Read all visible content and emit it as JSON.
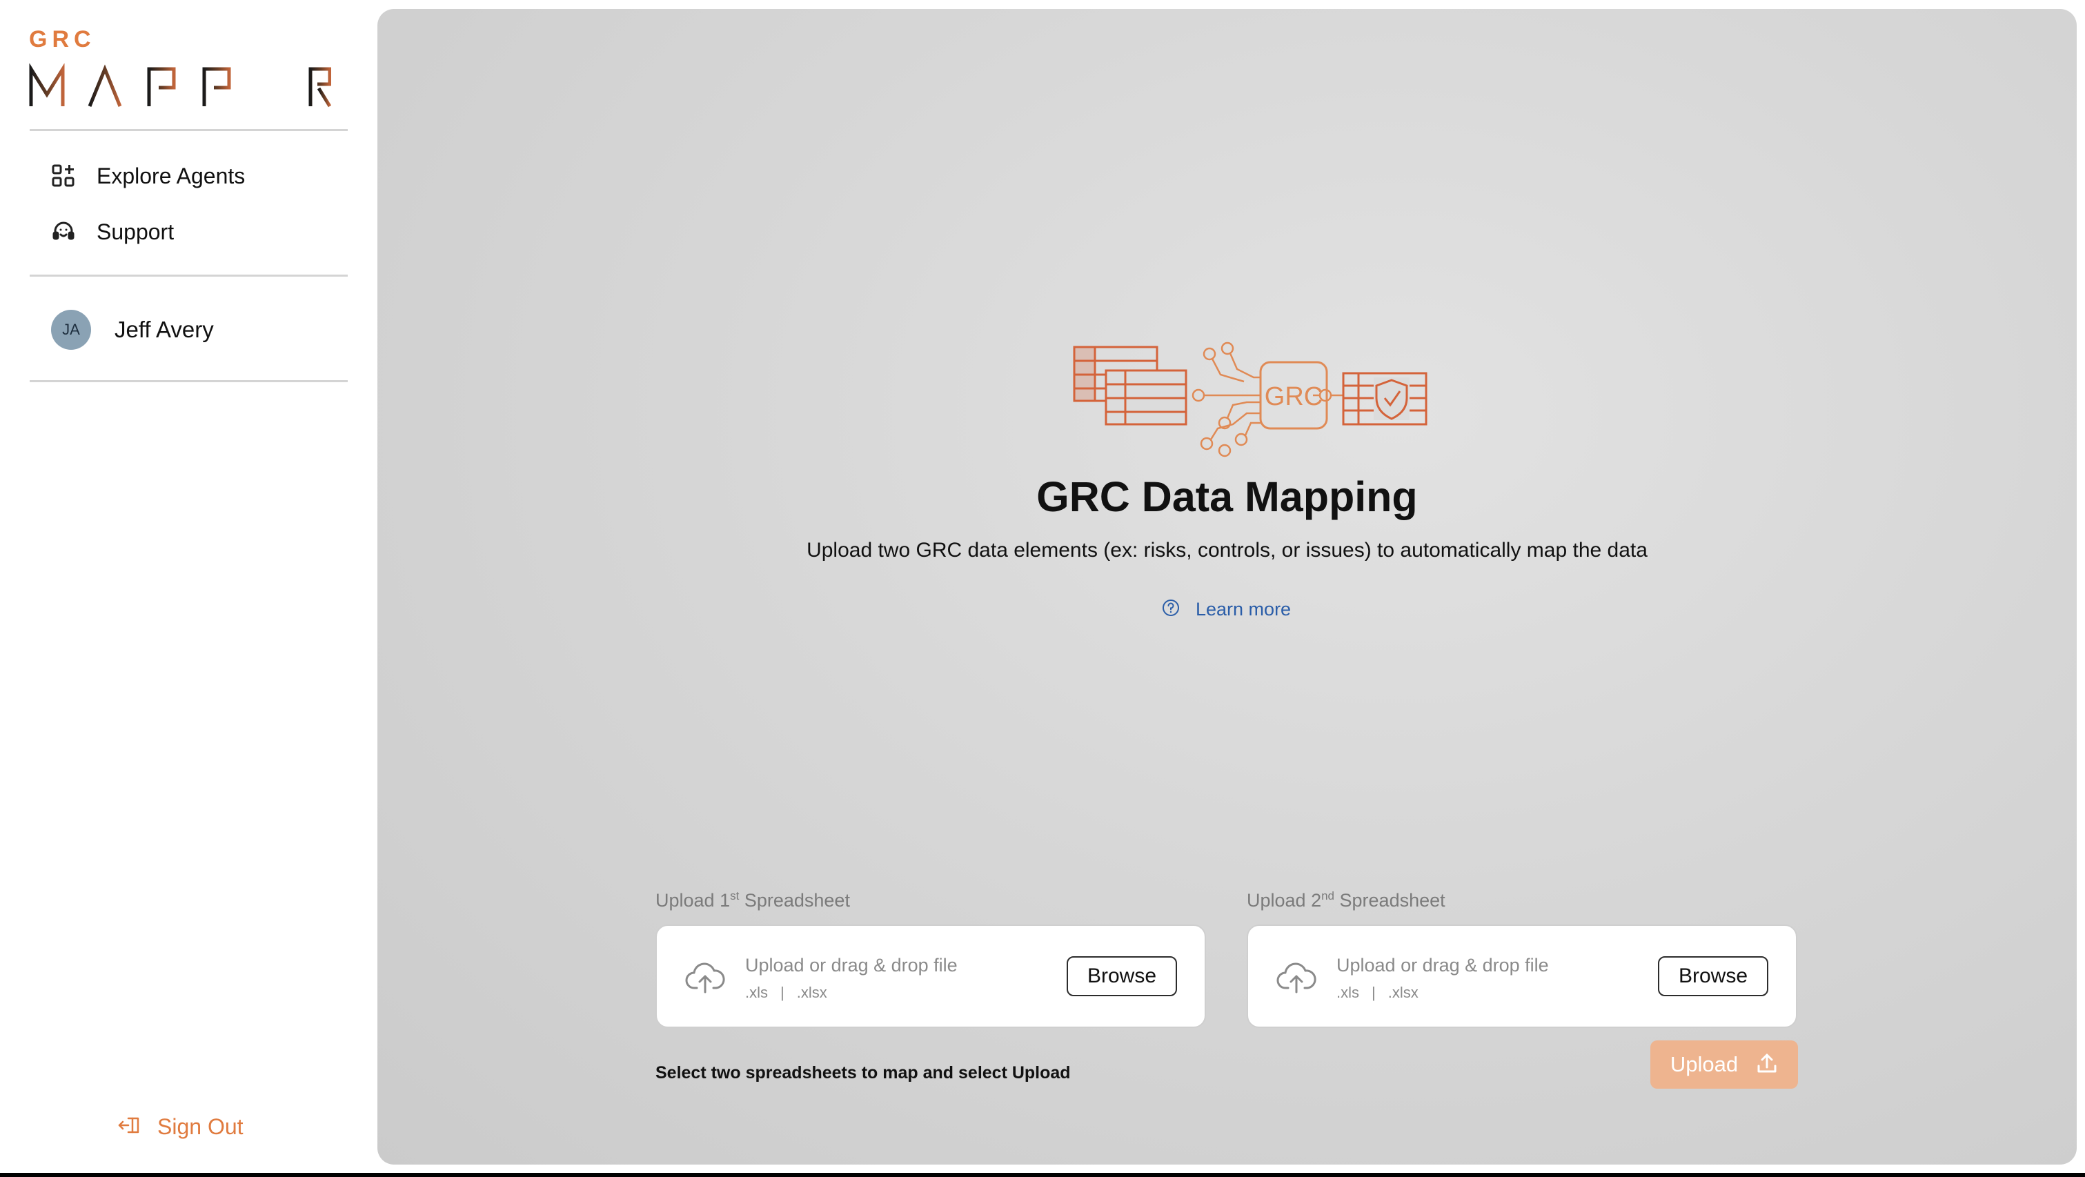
{
  "theme": {
    "accent": "#e07b3f",
    "link": "#2a5da8",
    "upload_disabled_bg": "#eeb48f"
  },
  "sidebar": {
    "logo_small": "GRC",
    "logo_big": "MAPPER",
    "nav": [
      {
        "label": "Explore Agents",
        "icon": "apps-add-icon"
      },
      {
        "label": "Support",
        "icon": "headset-icon"
      }
    ],
    "user": {
      "initials": "JA",
      "name": "Jeff Avery"
    },
    "signout": {
      "label": "Sign Out",
      "icon": "sign-out-icon"
    }
  },
  "main": {
    "illustration_text": "GRC",
    "title": "GRC Data Mapping",
    "subtitle": "Upload two GRC data elements (ex: risks, controls, or issues) to automatically map the data",
    "learn_more": "Learn more",
    "uploads": [
      {
        "label_prefix": "Upload 1",
        "label_sup": "st",
        "label_suffix": " Spreadsheet",
        "prompt": "Upload or drag & drop file",
        "formats": [
          ".xls",
          "|",
          ".xlsx"
        ],
        "browse": "Browse"
      },
      {
        "label_prefix": "Upload 2",
        "label_sup": "nd",
        "label_suffix": " Spreadsheet",
        "prompt": "Upload or drag & drop file",
        "formats": [
          ".xls",
          "|",
          ".xlsx"
        ],
        "browse": "Browse"
      }
    ],
    "hint": "Select two spreadsheets to map and select Upload",
    "upload_button": "Upload"
  }
}
